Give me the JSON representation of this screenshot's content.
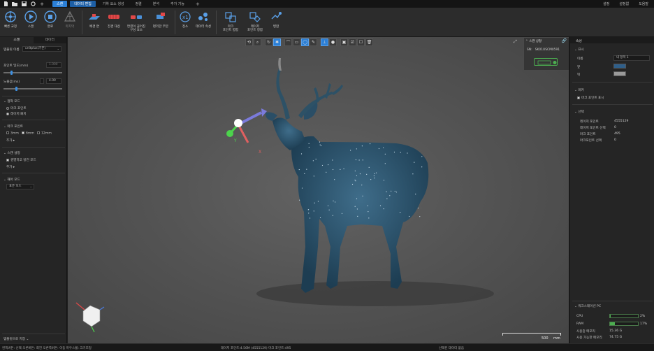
{
  "menubar": {
    "tabs": [
      {
        "label": "스캔",
        "state": "active"
      },
      {
        "label": "데이터 편집",
        "state": "highlight"
      },
      {
        "label": "기하 요소 생성",
        "state": ""
      },
      {
        "label": "정렬",
        "state": ""
      },
      {
        "label": "분석",
        "state": ""
      },
      {
        "label": "추가 기능",
        "state": ""
      }
    ],
    "add_tab": "+",
    "right": [
      "설정",
      "설정없",
      "도움말"
    ]
  },
  "ribbon": {
    "buttons": [
      {
        "label": "빠른 교정",
        "icon": "calibrate-icon"
      },
      {
        "label": "스캔",
        "icon": "play-icon"
      },
      {
        "label": "완료",
        "icon": "stop-icon"
      },
      {
        "label": "마지막",
        "icon": "mesh-icon"
      },
      {
        "label": "배경 면",
        "icon": "background-plane-icon"
      },
      {
        "label": "전경 대상",
        "icon": "foreground-object-icon"
      },
      {
        "label": "연결이 끊어진\n구성 요소",
        "icon": "disconnected-components-icon"
      },
      {
        "label": "편리한 부분",
        "icon": "convenient-part-icon"
      },
      {
        "label": "정소",
        "icon": "simplify-icon"
      },
      {
        "label": "데이터 속성",
        "icon": "data-properties-icon"
      },
      {
        "label": "마크\n포인트 병합",
        "icon": "marker-merge-icon"
      },
      {
        "label": "레이저\n포인트 정합",
        "icon": "laser-merge-icon"
      },
      {
        "label": "병합",
        "icon": "merge-icon"
      }
    ]
  },
  "left_panel": {
    "tabs": [
      "스캔",
      "데이터"
    ],
    "template_label": "템플릿 이름",
    "template_value": "unitplus(기본)",
    "point_distance_label": "포인트 밀도(mm)",
    "point_distance_value": "1.000",
    "exposure_label": "노출값(ms)",
    "exposure_value": "4.00",
    "section_scan_mode": "접착 모드",
    "mode_options": [
      {
        "label": "마크 포인트",
        "checked": false
      },
      {
        "label": "레이저 패치",
        "checked": true
      }
    ],
    "section_marker": "마크 포인트",
    "marker_sizes": [
      {
        "label": "3mm",
        "checked": false
      },
      {
        "label": "6mm",
        "checked": true
      },
      {
        "label": "12mm",
        "checked": false
      }
    ],
    "add_more": "추가",
    "section_scan_settings": "스캔 설정",
    "setting_option": "경영하고 방전 모드",
    "add_more2": "추가",
    "section_camera_mode": "해어 모드",
    "camera_mode_value": "표준 모드",
    "save_template": "템플릿으로 저장"
  },
  "viewport": {
    "scan_status_title": "스캔 상황",
    "scan_status_sn_label": "SN:",
    "scan_status_sn_value": "SK01USCM0591",
    "scalebar_value": "500",
    "scalebar_unit": "mm",
    "axis_x": "X",
    "axis_y": "Y"
  },
  "right_panel": {
    "tab": "속성",
    "section_display": "표시",
    "name_label": "이름",
    "name_value": "내 항목 1",
    "color_label": "앞",
    "back_label": "뒤",
    "colors": {
      "front": "#2f5f8a",
      "back": "#9a9a9a",
      "accent": "#2b7fd6",
      "cpu_bar": "#3a5c3a",
      "ram_bar": "#4caf50"
    },
    "section_marker": "마커",
    "marker_option": "마크 포인트 표시",
    "section_select": "선택",
    "stats": [
      {
        "label": "레이저 포인트",
        "value": "4555129"
      },
      {
        "label": "레이저 포인트 선택",
        "value": "0"
      },
      {
        "label": "마크 포인트",
        "value": "495"
      },
      {
        "label": "마크포인트 선택",
        "value": "0"
      }
    ],
    "section_workstation": "워크스테이션 PC",
    "cpu_label": "CPU",
    "cpu_value": "2%",
    "cpu_fraction": 0.02,
    "ram_label": "RAM",
    "ram_value": "17%",
    "ram_fraction": 0.17,
    "mem_used_label": "사용중 메모리",
    "mem_used_value": "15.36 G",
    "mem_avail_label": "사용 가능한 메모리",
    "mem_avail_value": "74.75 G"
  },
  "statusbar": {
    "left": "왼쪽버튼: 선택 오른버튼: 회전 오른쪽버튼: 이동 마우스휠: 크기조정",
    "middle": "레이저 포인트:4.56M (4555129) 마크 포인트:495",
    "right": "선택된 데이터 없음"
  }
}
